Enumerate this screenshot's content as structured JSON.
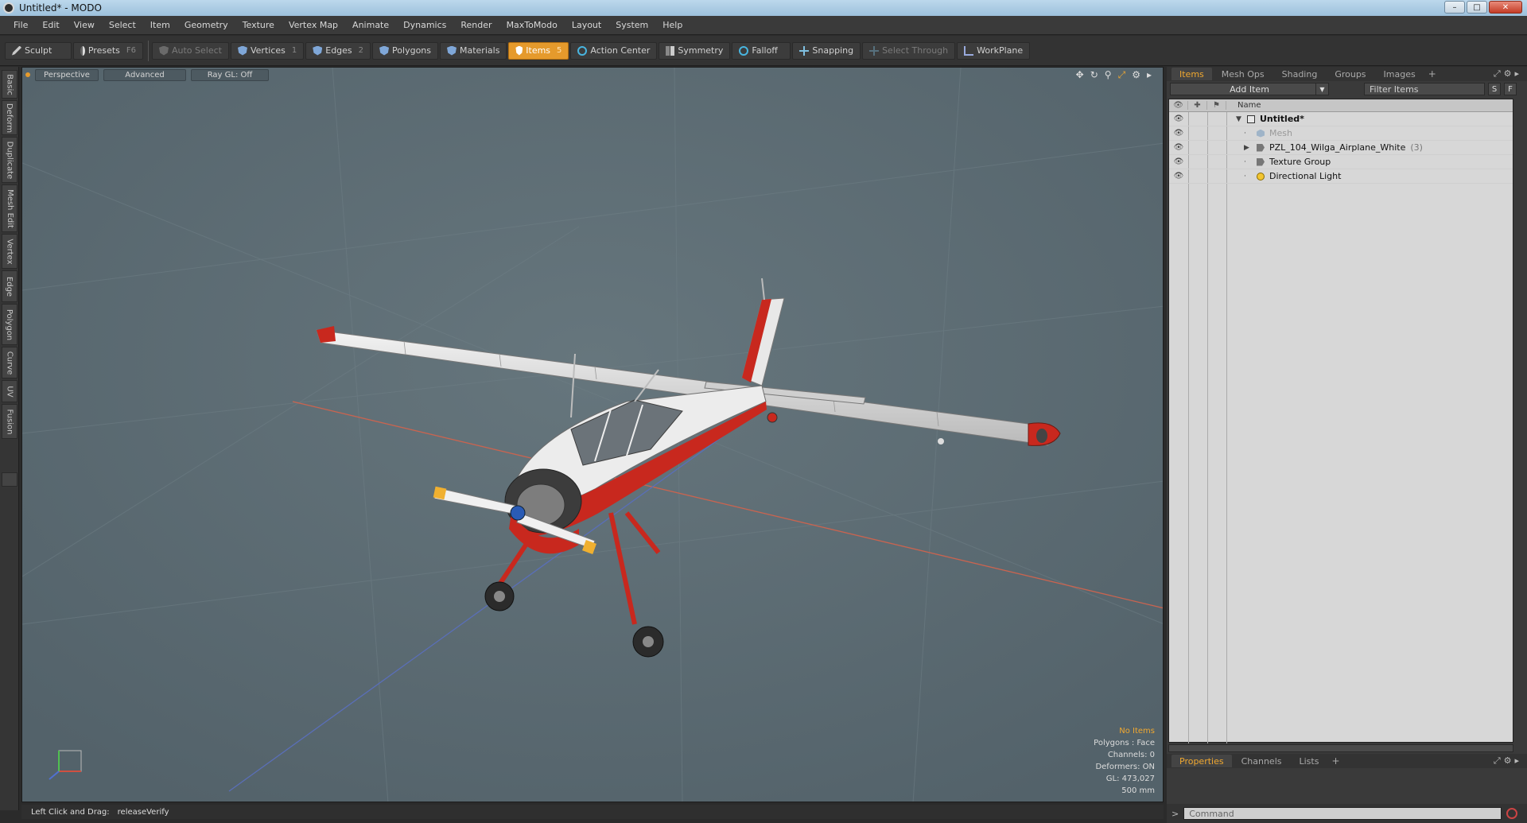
{
  "window": {
    "title": "Untitled* - MODO",
    "minimize": "–",
    "maximize": "□",
    "close": "✕"
  },
  "menu": [
    "File",
    "Edit",
    "View",
    "Select",
    "Item",
    "Geometry",
    "Texture",
    "Vertex Map",
    "Animate",
    "Dynamics",
    "Render",
    "MaxToModo",
    "Layout",
    "System",
    "Help"
  ],
  "toolbar": {
    "sculpt": "Sculpt",
    "presets": "Presets",
    "presets_key": "F6",
    "auto_select": "Auto Select",
    "vertices": "Vertices",
    "vertices_key": "1",
    "edges": "Edges",
    "edges_key": "2",
    "polygons": "Polygons",
    "materials": "Materials",
    "items": "Items",
    "items_key": "5",
    "action_center": "Action Center",
    "symmetry": "Symmetry",
    "falloff": "Falloff",
    "snapping": "Snapping",
    "select_through": "Select Through",
    "workplane": "WorkPlane"
  },
  "left_tabs": [
    "Basic",
    "Deform",
    "Duplicate",
    "Mesh Edit",
    "Vertex",
    "Edge",
    "Polygon",
    "Curve",
    "UV",
    "Fusion"
  ],
  "viewport": {
    "tabs": [
      "Perspective",
      "Advanced",
      "Ray GL: Off"
    ],
    "info": {
      "selection": "No Items",
      "polygons": "Polygons : Face",
      "channels": "Channels: 0",
      "deformers": "Deformers: ON",
      "gl": "GL: 473,027",
      "scale": "500 mm"
    }
  },
  "status": {
    "hint_label": "Left Click and Drag:",
    "hint_action": "releaseVerify"
  },
  "items_panel": {
    "tabs": [
      "Items",
      "Mesh Ops",
      "Shading",
      "Groups",
      "Images"
    ],
    "add_item": "Add Item",
    "filter_placeholder": "Filter Items",
    "btn_s": "S",
    "btn_f": "F",
    "column_name": "Name",
    "tree": [
      {
        "label": "Untitled*",
        "type": "scene",
        "depth": 0,
        "expanded": true
      },
      {
        "label": "Mesh",
        "type": "mesh",
        "depth": 1,
        "dim": true
      },
      {
        "label": "PZL_104_Wilga_Airplane_White",
        "type": "group",
        "depth": 1,
        "count": "(3)",
        "collapsed": true
      },
      {
        "label": "Texture Group",
        "type": "group",
        "depth": 1
      },
      {
        "label": "Directional Light",
        "type": "light",
        "depth": 1
      }
    ]
  },
  "properties_panel": {
    "tabs": [
      "Properties",
      "Channels",
      "Lists"
    ]
  },
  "command": {
    "prompt": ">",
    "placeholder": "Command"
  },
  "colors": {
    "accent": "#e59a2c",
    "viewport_bg": "#5a6a72",
    "airplane_red": "#c8281e"
  }
}
